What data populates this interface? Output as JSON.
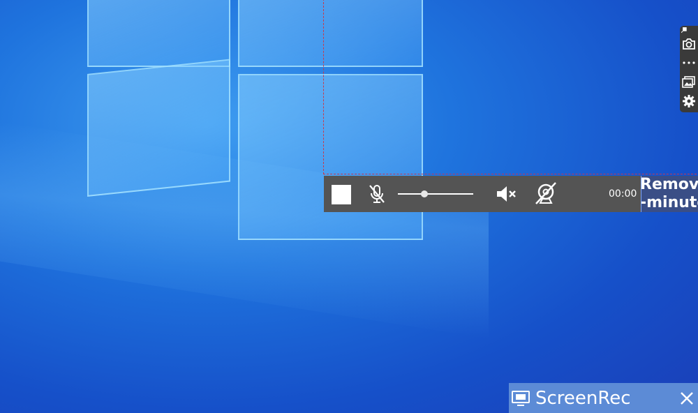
{
  "recorder": {
    "timer": "00:00",
    "volume_level": 0.35,
    "overlay_lines": [
      "Remove",
      "-minute"
    ]
  },
  "notice": {
    "app_name": "ScreenRec"
  },
  "icons": {
    "stop": "stop-square-icon",
    "mic": "microphone-muted-icon",
    "speaker": "speaker-muted-icon",
    "webcam": "webcam-off-icon",
    "pin": "pin-icon",
    "camera": "camera-icon",
    "more": "more-dots-icon",
    "gallery": "image-gallery-icon",
    "settings": "gear-icon",
    "monitor": "monitor-icon",
    "close": "close-icon"
  },
  "colors": {
    "recorder_bar": "#545454",
    "region_border": "#c8384a",
    "notice_bg": "#5c8bd6",
    "side_toolbar": "#3a3a3a"
  }
}
